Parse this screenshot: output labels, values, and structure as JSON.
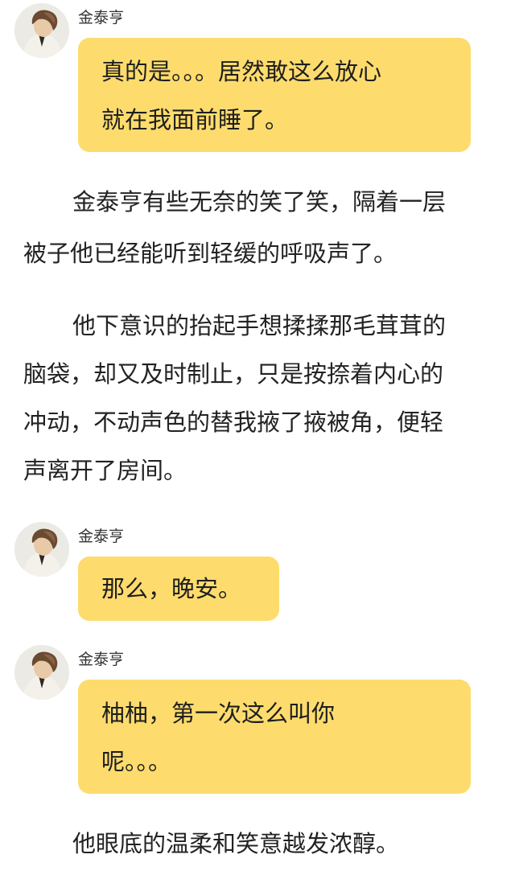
{
  "sender_name": "金泰亨",
  "avatar_icon": "person-avatar-icon",
  "colors": {
    "bubble": "#fddc6d",
    "text": "#222222",
    "background": "#ffffff"
  },
  "messages": [
    {
      "sender": "金泰亨",
      "lines": [
        "真的是。。。居然敢这么放心",
        "就在我面前睡了。"
      ]
    },
    {
      "sender": "金泰亨",
      "lines": [
        "那么，晚安。"
      ]
    },
    {
      "sender": "金泰亨",
      "lines": [
        "柚柚，第一次这么叫你",
        "呢。。。"
      ]
    }
  ],
  "paragraphs": [
    {
      "lines": [
        "金泰亨有些无奈的笑了笑，隔着一层",
        "被子他已经能听到轻缓的呼吸声了。"
      ]
    },
    {
      "lines": [
        "他下意识的抬起手想揉揉那毛茸茸的",
        "脑袋，却又及时制止，只是按捺着内心的",
        "冲动，不动声色的替我掖了掖被角，便轻",
        "声离开了房间。"
      ]
    },
    {
      "lines": [
        "他眼底的温柔和笑意越发浓醇。"
      ]
    }
  ]
}
